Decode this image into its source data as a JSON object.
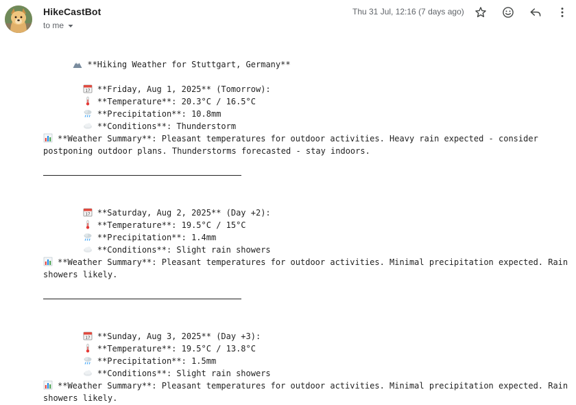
{
  "header": {
    "sender": "HikeCastBot",
    "to": "to me",
    "date": "Thu 31 Jul, 12:16 (7 days ago)"
  },
  "body": {
    "title": "**Hiking Weather for Stuttgart, Germany**",
    "days": [
      {
        "date_line": "**Friday, Aug 1, 2025** (Tomorrow):",
        "temperature": "**Temperature**: 20.3°C / 16.5°C",
        "precipitation": "**Precipitation**: 10.8mm",
        "conditions": "**Conditions**: Thunderstorm",
        "summary": "**Weather Summary**: Pleasant temperatures for outdoor activities. Heavy rain expected - consider postponing outdoor plans. Thunderstorms forecasted - stay indoors."
      },
      {
        "date_line": "**Saturday, Aug 2, 2025** (Day +2):",
        "temperature": "**Temperature**: 19.5°C / 15°C",
        "precipitation": "**Precipitation**: 1.4mm",
        "conditions": "**Conditions**: Slight rain showers",
        "summary": "**Weather Summary**: Pleasant temperatures for outdoor activities. Minimal precipitation expected. Rain showers likely."
      },
      {
        "date_line": "**Sunday, Aug 3, 2025** (Day +3):",
        "temperature": "**Temperature**: 19.5°C / 13.8°C",
        "precipitation": "**Precipitation**: 1.5mm",
        "conditions": "**Conditions**: Slight rain showers",
        "summary": "**Weather Summary**: Pleasant temperatures for outdoor activities. Minimal precipitation expected. Rain showers likely."
      }
    ]
  },
  "icons": {
    "title": "mountain-icon",
    "date": "calendar-icon",
    "temperature": "thermometer-icon",
    "precipitation": "rain-cloud-icon",
    "conditions": "cloud-icon",
    "summary": "bar-chart-icon"
  }
}
